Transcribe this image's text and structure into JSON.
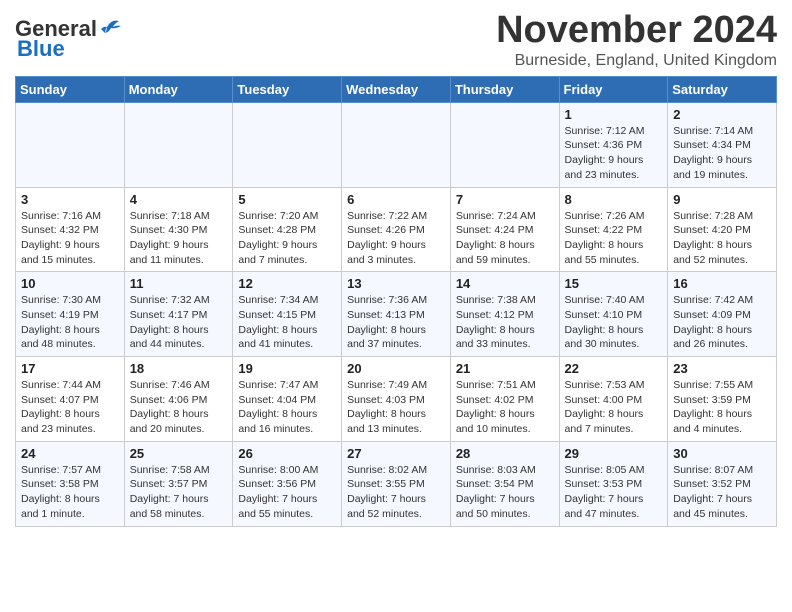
{
  "header": {
    "logo_general": "General",
    "logo_blue": "Blue",
    "month_title": "November 2024",
    "location": "Burneside, England, United Kingdom"
  },
  "days_of_week": [
    "Sunday",
    "Monday",
    "Tuesday",
    "Wednesday",
    "Thursday",
    "Friday",
    "Saturday"
  ],
  "weeks": [
    [
      {
        "day": "",
        "info": ""
      },
      {
        "day": "",
        "info": ""
      },
      {
        "day": "",
        "info": ""
      },
      {
        "day": "",
        "info": ""
      },
      {
        "day": "",
        "info": ""
      },
      {
        "day": "1",
        "info": "Sunrise: 7:12 AM\nSunset: 4:36 PM\nDaylight: 9 hours\nand 23 minutes."
      },
      {
        "day": "2",
        "info": "Sunrise: 7:14 AM\nSunset: 4:34 PM\nDaylight: 9 hours\nand 19 minutes."
      }
    ],
    [
      {
        "day": "3",
        "info": "Sunrise: 7:16 AM\nSunset: 4:32 PM\nDaylight: 9 hours\nand 15 minutes."
      },
      {
        "day": "4",
        "info": "Sunrise: 7:18 AM\nSunset: 4:30 PM\nDaylight: 9 hours\nand 11 minutes."
      },
      {
        "day": "5",
        "info": "Sunrise: 7:20 AM\nSunset: 4:28 PM\nDaylight: 9 hours\nand 7 minutes."
      },
      {
        "day": "6",
        "info": "Sunrise: 7:22 AM\nSunset: 4:26 PM\nDaylight: 9 hours\nand 3 minutes."
      },
      {
        "day": "7",
        "info": "Sunrise: 7:24 AM\nSunset: 4:24 PM\nDaylight: 8 hours\nand 59 minutes."
      },
      {
        "day": "8",
        "info": "Sunrise: 7:26 AM\nSunset: 4:22 PM\nDaylight: 8 hours\nand 55 minutes."
      },
      {
        "day": "9",
        "info": "Sunrise: 7:28 AM\nSunset: 4:20 PM\nDaylight: 8 hours\nand 52 minutes."
      }
    ],
    [
      {
        "day": "10",
        "info": "Sunrise: 7:30 AM\nSunset: 4:19 PM\nDaylight: 8 hours\nand 48 minutes."
      },
      {
        "day": "11",
        "info": "Sunrise: 7:32 AM\nSunset: 4:17 PM\nDaylight: 8 hours\nand 44 minutes."
      },
      {
        "day": "12",
        "info": "Sunrise: 7:34 AM\nSunset: 4:15 PM\nDaylight: 8 hours\nand 41 minutes."
      },
      {
        "day": "13",
        "info": "Sunrise: 7:36 AM\nSunset: 4:13 PM\nDaylight: 8 hours\nand 37 minutes."
      },
      {
        "day": "14",
        "info": "Sunrise: 7:38 AM\nSunset: 4:12 PM\nDaylight: 8 hours\nand 33 minutes."
      },
      {
        "day": "15",
        "info": "Sunrise: 7:40 AM\nSunset: 4:10 PM\nDaylight: 8 hours\nand 30 minutes."
      },
      {
        "day": "16",
        "info": "Sunrise: 7:42 AM\nSunset: 4:09 PM\nDaylight: 8 hours\nand 26 minutes."
      }
    ],
    [
      {
        "day": "17",
        "info": "Sunrise: 7:44 AM\nSunset: 4:07 PM\nDaylight: 8 hours\nand 23 minutes."
      },
      {
        "day": "18",
        "info": "Sunrise: 7:46 AM\nSunset: 4:06 PM\nDaylight: 8 hours\nand 20 minutes."
      },
      {
        "day": "19",
        "info": "Sunrise: 7:47 AM\nSunset: 4:04 PM\nDaylight: 8 hours\nand 16 minutes."
      },
      {
        "day": "20",
        "info": "Sunrise: 7:49 AM\nSunset: 4:03 PM\nDaylight: 8 hours\nand 13 minutes."
      },
      {
        "day": "21",
        "info": "Sunrise: 7:51 AM\nSunset: 4:02 PM\nDaylight: 8 hours\nand 10 minutes."
      },
      {
        "day": "22",
        "info": "Sunrise: 7:53 AM\nSunset: 4:00 PM\nDaylight: 8 hours\nand 7 minutes."
      },
      {
        "day": "23",
        "info": "Sunrise: 7:55 AM\nSunset: 3:59 PM\nDaylight: 8 hours\nand 4 minutes."
      }
    ],
    [
      {
        "day": "24",
        "info": "Sunrise: 7:57 AM\nSunset: 3:58 PM\nDaylight: 8 hours\nand 1 minute."
      },
      {
        "day": "25",
        "info": "Sunrise: 7:58 AM\nSunset: 3:57 PM\nDaylight: 7 hours\nand 58 minutes."
      },
      {
        "day": "26",
        "info": "Sunrise: 8:00 AM\nSunset: 3:56 PM\nDaylight: 7 hours\nand 55 minutes."
      },
      {
        "day": "27",
        "info": "Sunrise: 8:02 AM\nSunset: 3:55 PM\nDaylight: 7 hours\nand 52 minutes."
      },
      {
        "day": "28",
        "info": "Sunrise: 8:03 AM\nSunset: 3:54 PM\nDaylight: 7 hours\nand 50 minutes."
      },
      {
        "day": "29",
        "info": "Sunrise: 8:05 AM\nSunset: 3:53 PM\nDaylight: 7 hours\nand 47 minutes."
      },
      {
        "day": "30",
        "info": "Sunrise: 8:07 AM\nSunset: 3:52 PM\nDaylight: 7 hours\nand 45 minutes."
      }
    ]
  ]
}
